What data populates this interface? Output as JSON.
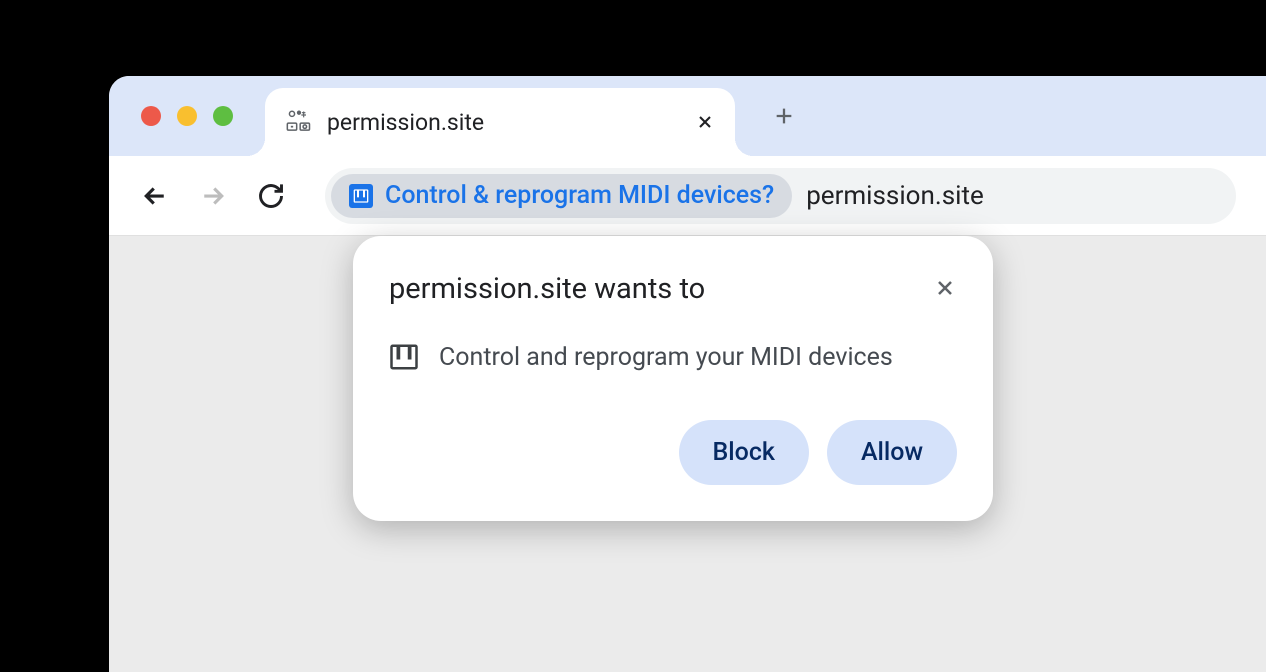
{
  "tab": {
    "title": "permission.site"
  },
  "address_bar": {
    "chip_label": "Control & reprogram MIDI devices?",
    "url": "permission.site"
  },
  "prompt": {
    "title": "permission.site wants to",
    "description": "Control and reprogram your MIDI devices",
    "block_label": "Block",
    "allow_label": "Allow"
  }
}
